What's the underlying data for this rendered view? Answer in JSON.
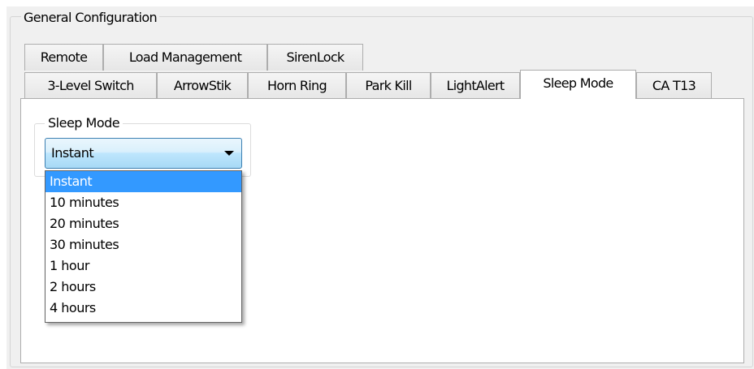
{
  "group": {
    "title": "General Configuration"
  },
  "tabs": {
    "row1": [
      {
        "label": "Remote"
      },
      {
        "label": "Load Management"
      },
      {
        "label": "SirenLock"
      }
    ],
    "row2": [
      {
        "label": "3-Level Switch"
      },
      {
        "label": "ArrowStik"
      },
      {
        "label": "Horn Ring"
      },
      {
        "label": "Park Kill"
      },
      {
        "label": "LightAlert"
      },
      {
        "label": "Sleep Mode"
      },
      {
        "label": "CA T13"
      }
    ],
    "active": "Sleep Mode"
  },
  "sleep_mode": {
    "group_title": "Sleep Mode",
    "selected_value": "Instant",
    "options": [
      "Instant",
      "10 minutes",
      "20 minutes",
      "30 minutes",
      "1 hour",
      "2 hours",
      "4 hours"
    ],
    "highlighted_option": "Instant"
  },
  "colors": {
    "highlight": "#3399ff",
    "combo_border": "#3c7fb1",
    "window_bg": "#f0f0f0"
  }
}
